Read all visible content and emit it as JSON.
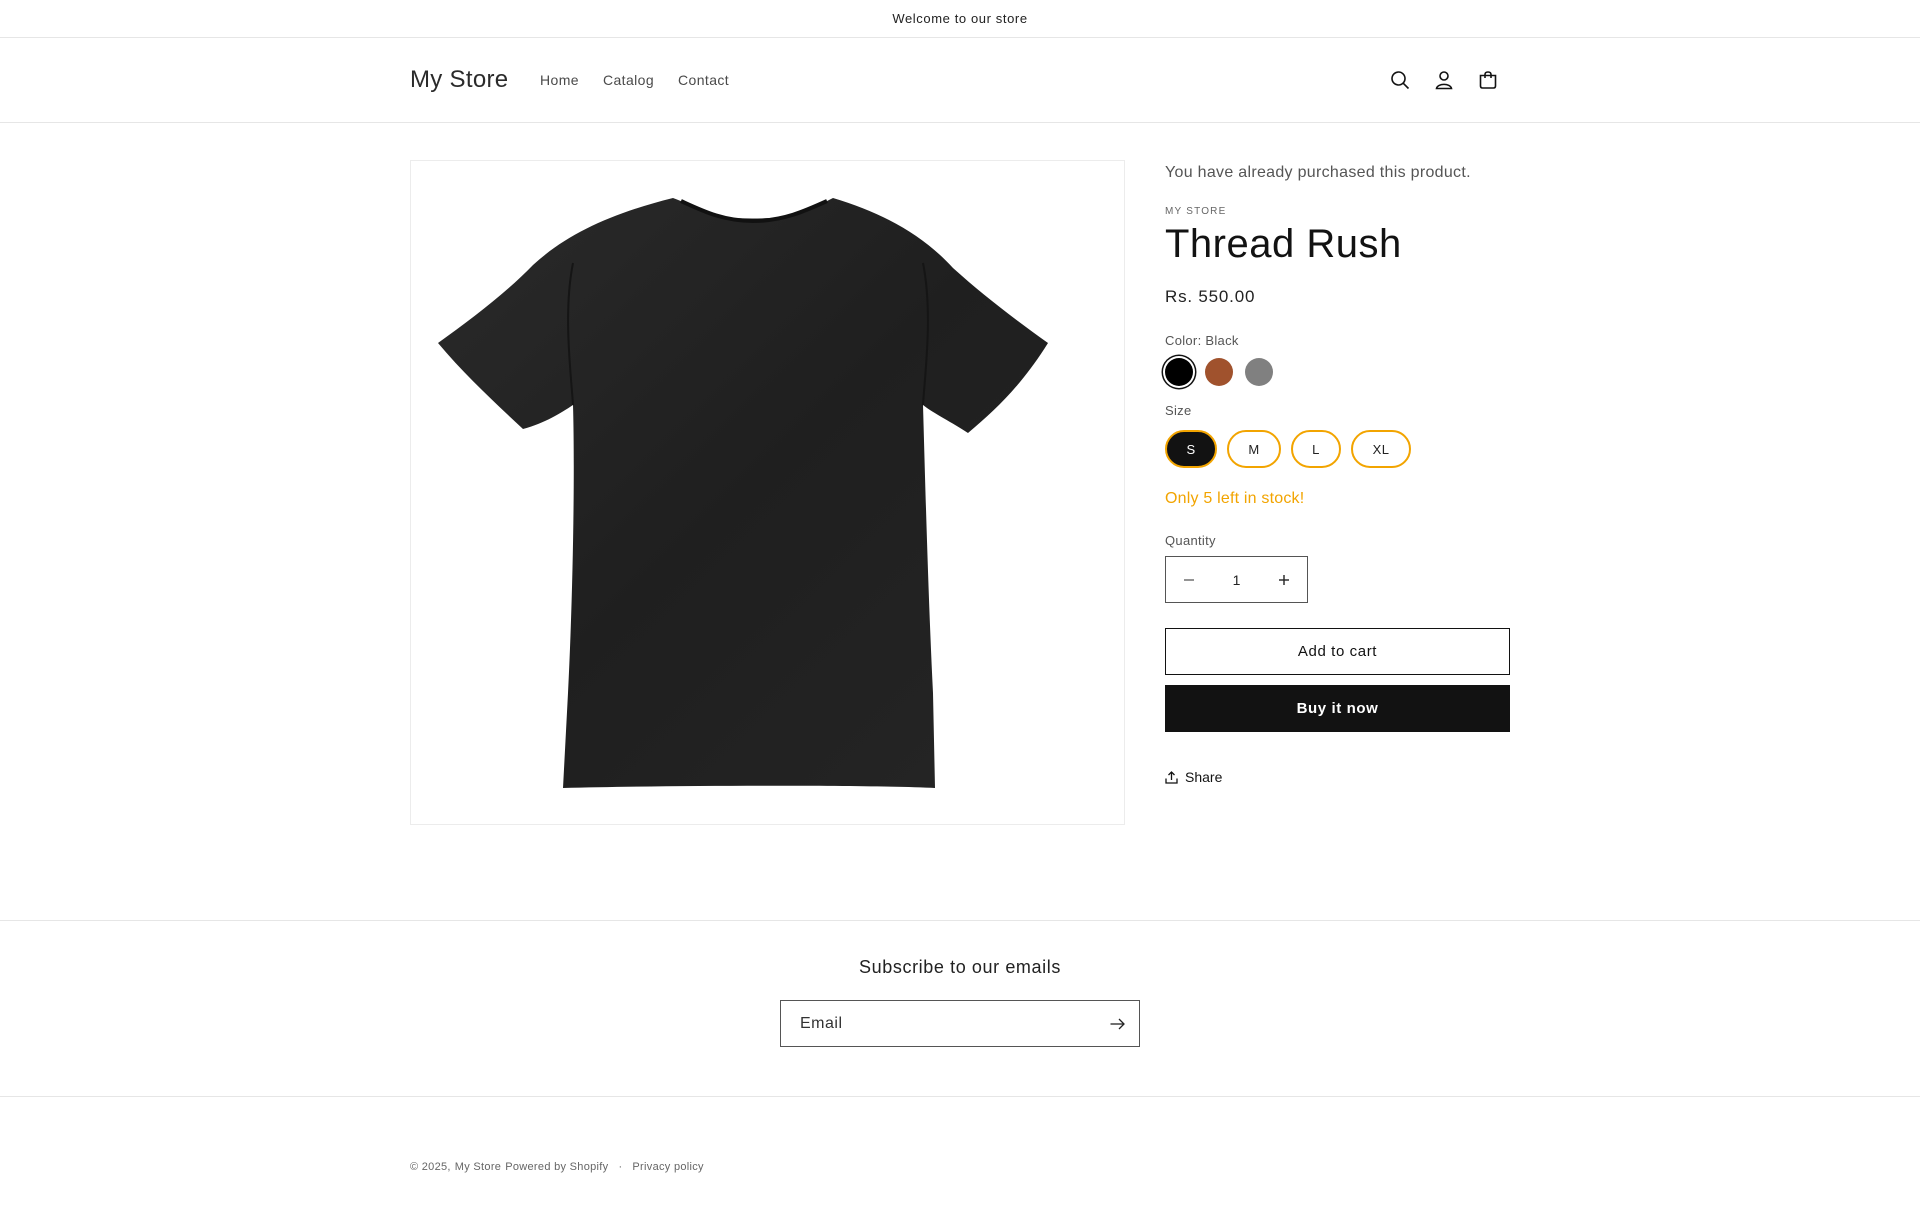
{
  "announcement": {
    "text": "Welcome to our store"
  },
  "header": {
    "logo": "My Store",
    "nav": [
      {
        "label": "Home"
      },
      {
        "label": "Catalog"
      },
      {
        "label": "Contact"
      }
    ],
    "icons": [
      "search-icon",
      "account-icon",
      "cart-icon"
    ]
  },
  "product": {
    "purchased_notice": "You have already purchased this product.",
    "vendor": "MY STORE",
    "title": "Thread Rush",
    "price": "Rs. 550.00",
    "color_label": "Color: Black",
    "colors": [
      {
        "name": "Black",
        "hex": "#000000",
        "selected": true
      },
      {
        "name": "Brown",
        "hex": "#a0522d",
        "selected": false
      },
      {
        "name": "Gray",
        "hex": "#808080",
        "selected": false
      }
    ],
    "size_label": "Size",
    "sizes": [
      {
        "label": "S",
        "selected": true
      },
      {
        "label": "M",
        "selected": false
      },
      {
        "label": "L",
        "selected": false
      },
      {
        "label": "XL",
        "selected": false
      }
    ],
    "stock_message": "Only 5 left in stock!",
    "quantity_label": "Quantity",
    "quantity": "1",
    "add_to_cart": "Add to cart",
    "buy_now": "Buy it now",
    "share": "Share",
    "image": "black-tshirt"
  },
  "newsletter": {
    "title": "Subscribe to our emails",
    "placeholder": "Email"
  },
  "footer": {
    "copyright": "© 2025,",
    "store_link": "My Store",
    "powered": "Powered by Shopify",
    "separator": "·",
    "privacy": "Privacy policy"
  },
  "colors": {
    "accent": "#f2a400",
    "primary": "#121212"
  }
}
